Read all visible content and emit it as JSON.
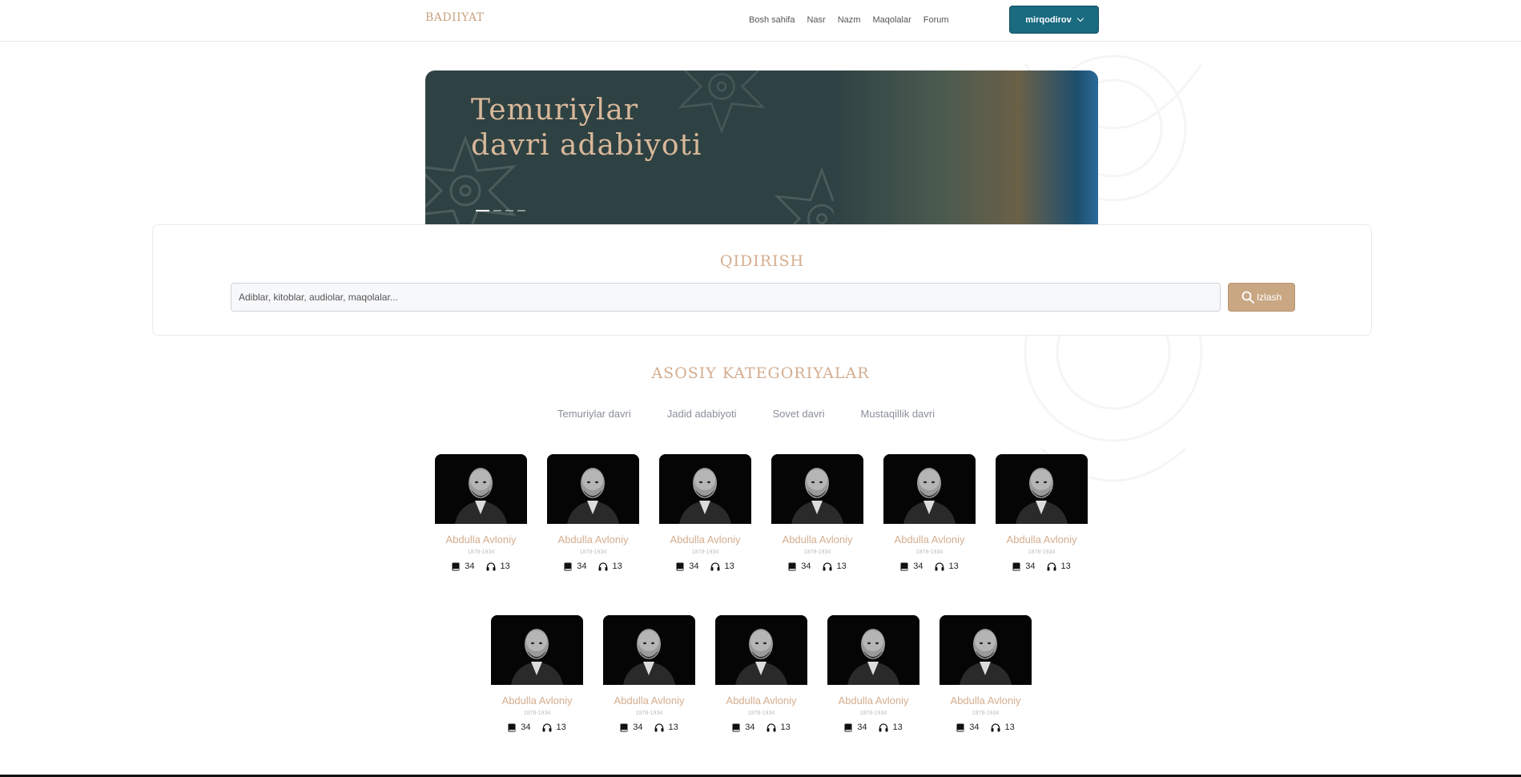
{
  "header": {
    "logo": "BADIIYAT",
    "nav": [
      "Bosh sahifa",
      "Nasr",
      "Nazm",
      "Maqolalar",
      "Forum"
    ],
    "user_button": "mirqodirov"
  },
  "banner": {
    "title": "Temuriylar davri adabiyoti",
    "slides": 4,
    "active_slide": 1
  },
  "search": {
    "title": "QIDIRISH",
    "placeholder": "Adiblar, kitoblar, audiolar, maqolalar...",
    "button": "Izlash"
  },
  "categories": {
    "title": "ASOSIY KATEGORIYALAR",
    "tabs": [
      "Temuriylar davri",
      "Jadid adabiyoti",
      "Sovet davri",
      "Mustaqillik davri"
    ]
  },
  "authors": [
    {
      "name": "Abdulla Avloniy",
      "years": "1878-1934",
      "books": "34",
      "audios": "13"
    },
    {
      "name": "Abdulla Avloniy",
      "years": "1878-1934",
      "books": "34",
      "audios": "13"
    },
    {
      "name": "Abdulla Avloniy",
      "years": "1878-1934",
      "books": "34",
      "audios": "13"
    },
    {
      "name": "Abdulla Avloniy",
      "years": "1878-1934",
      "books": "34",
      "audios": "13"
    },
    {
      "name": "Abdulla Avloniy",
      "years": "1878-1934",
      "books": "34",
      "audios": "13"
    },
    {
      "name": "Abdulla Avloniy",
      "years": "1878-1934",
      "books": "34",
      "audios": "13"
    },
    {
      "name": "Abdulla Avloniy",
      "years": "1878-1934",
      "books": "34",
      "audios": "13"
    },
    {
      "name": "Abdulla Avloniy",
      "years": "1878-1934",
      "books": "34",
      "audios": "13"
    },
    {
      "name": "Abdulla Avloniy",
      "years": "1878-1934",
      "books": "34",
      "audios": "13"
    },
    {
      "name": "Abdulla Avloniy",
      "years": "1878-1934",
      "books": "34",
      "audios": "13"
    },
    {
      "name": "Abdulla Avloniy",
      "years": "1878-1934",
      "books": "34",
      "audios": "13"
    }
  ],
  "icons": {
    "book": "book-icon",
    "audio": "headphones-icon",
    "search": "search-icon",
    "dropdown": "chevron-down-icon"
  },
  "colors": {
    "accent": "#c9a783",
    "header_button": "#1a6a80",
    "banner": "#2f4243",
    "heading": "#d4ad8f"
  }
}
